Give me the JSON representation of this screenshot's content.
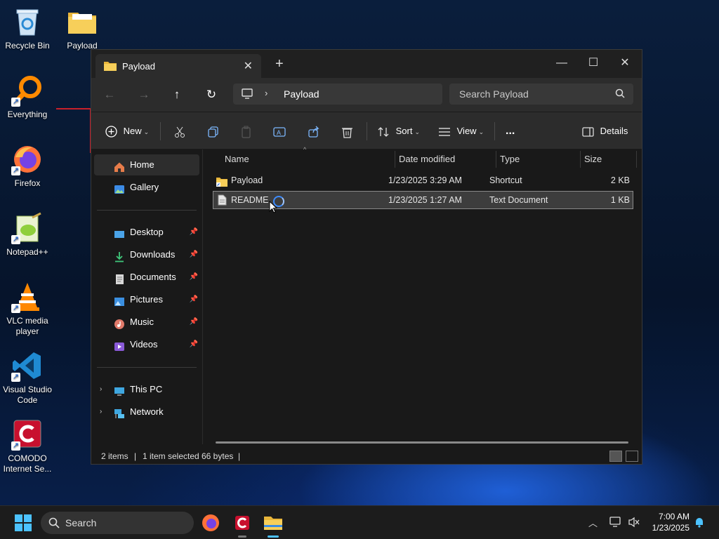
{
  "desktop": {
    "icons": [
      {
        "label": "Recycle Bin"
      },
      {
        "label": "Payload"
      },
      {
        "label": "Everything"
      },
      {
        "label": "Firefox"
      },
      {
        "label": "Notepad++"
      },
      {
        "label": "VLC media player"
      },
      {
        "label": "Visual Studio Code"
      },
      {
        "label": "COMODO Internet Se..."
      }
    ]
  },
  "explorer": {
    "tab_title": "Payload",
    "address": {
      "crumb": "Payload"
    },
    "search_placeholder": "Search Payload",
    "toolbar": {
      "new": "New",
      "sort": "Sort",
      "view": "View",
      "more": "...",
      "details": "Details"
    },
    "sidebar": {
      "quick": [
        {
          "label": "Home"
        },
        {
          "label": "Gallery"
        }
      ],
      "pinned": [
        {
          "label": "Desktop"
        },
        {
          "label": "Downloads"
        },
        {
          "label": "Documents"
        },
        {
          "label": "Pictures"
        },
        {
          "label": "Music"
        },
        {
          "label": "Videos"
        }
      ],
      "tree": [
        {
          "label": "This PC"
        },
        {
          "label": "Network"
        }
      ]
    },
    "columns": {
      "name": "Name",
      "date": "Date modified",
      "type": "Type",
      "size": "Size"
    },
    "files": [
      {
        "name": "Payload",
        "date": "1/23/2025 3:29 AM",
        "type": "Shortcut",
        "size": "2 KB"
      },
      {
        "name": "README",
        "date": "1/23/2025 1:27 AM",
        "type": "Text Document",
        "size": "1 KB"
      }
    ],
    "status": {
      "items": "2 items",
      "selected": "1 item selected",
      "bytes": "66 bytes"
    }
  },
  "taskbar": {
    "search_label": "Search",
    "time": "7:00 AM",
    "date": "1/23/2025"
  },
  "colors": {
    "accent": "#4cc2ff",
    "folder": "#f5c542",
    "selection": "#3d3d3d"
  }
}
